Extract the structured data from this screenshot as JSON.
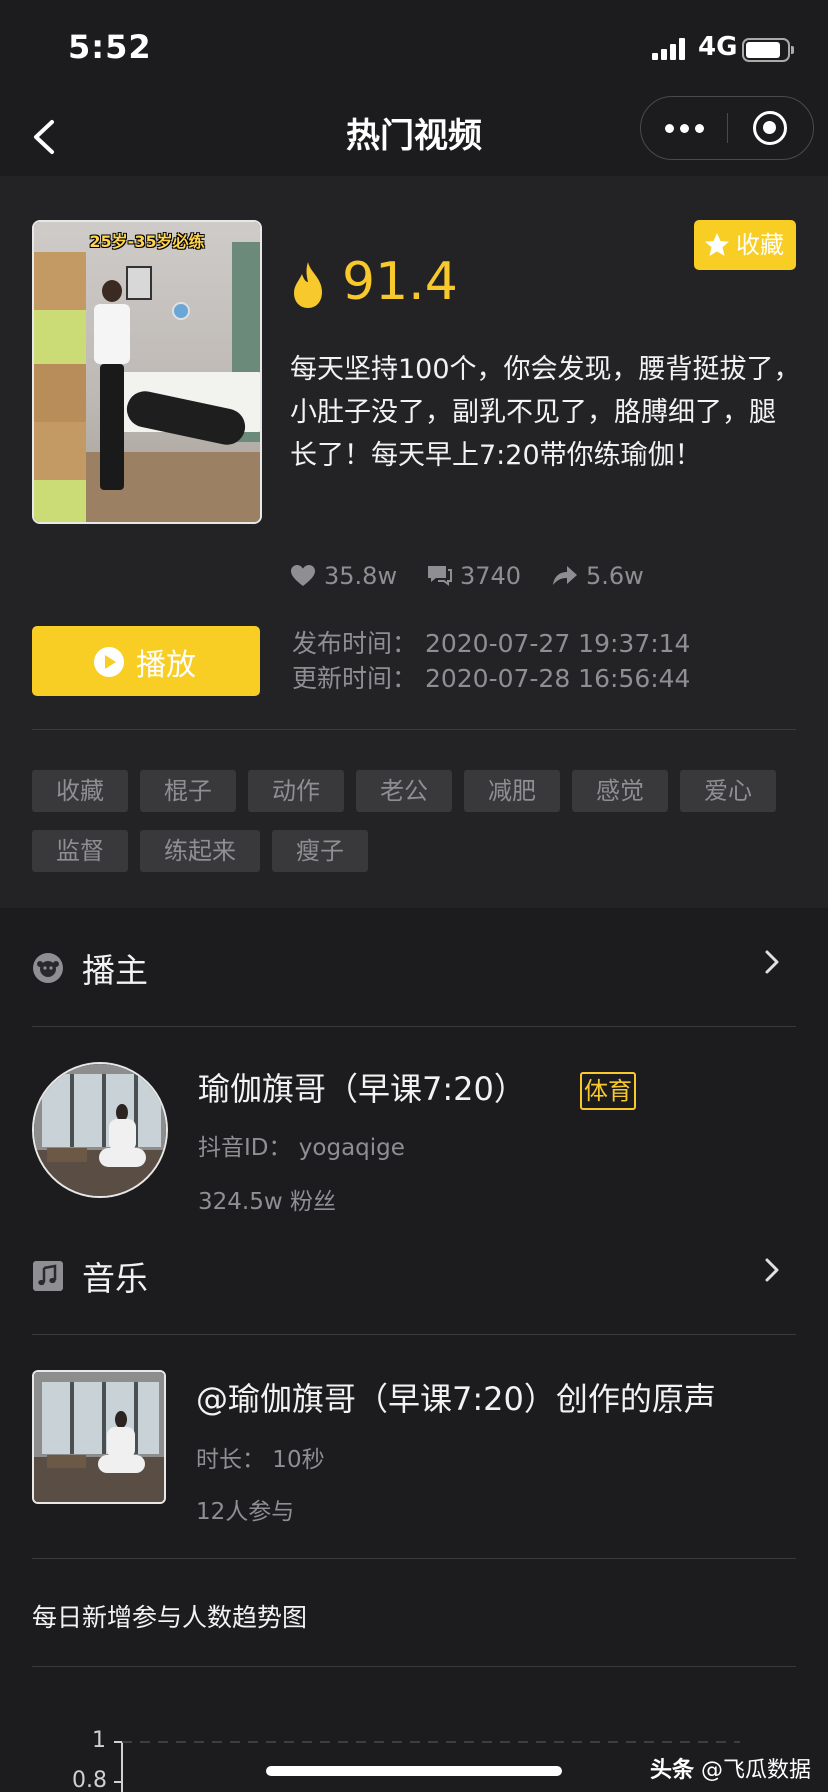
{
  "status_bar": {
    "time": "5:52",
    "network": "4G"
  },
  "nav": {
    "title": "热门视频"
  },
  "video": {
    "thumb_caption": "25岁-35岁必练",
    "favorite_label": "收藏",
    "heat_score": "91.4",
    "description": "每天坚持100个，你会发现，腰背挺拔了，小肚子没了，副乳不见了，胳膊细了，腿长了！每天早上7:20带你练瑜伽！",
    "likes": "35.8w",
    "comments": "3740",
    "shares": "5.6w",
    "play_label": "播放",
    "publish_time": "发布时间：  2020-07-27 19:37:14",
    "update_time": "更新时间：  2020-07-28 16:56:44",
    "tags": [
      "收藏",
      "棍子",
      "动作",
      "老公",
      "减肥",
      "感觉",
      "爱心",
      "监督",
      "练起来",
      "瘦子"
    ]
  },
  "host_section": {
    "title": "播主",
    "name": "瑜伽旗哥（早课7:20）",
    "category": "体育",
    "douyin_id": "抖音ID：  yogaqige",
    "fans": "324.5w 粉丝"
  },
  "music_section": {
    "title": "音乐",
    "name": "@瑜伽旗哥（早课7:20）创作的原声",
    "duration": "时长：  10秒",
    "participants": "12人参与"
  },
  "trend": {
    "title": "每日新增参与人数趋势图",
    "y_ticks": [
      "1",
      "0.8"
    ]
  },
  "watermark": {
    "brand": "头条",
    "handle": "@飞瓜数据"
  },
  "colors": {
    "accent": "#f8cd24",
    "score": "#f8c92c",
    "background": "#1c1c1e",
    "card": "#232326"
  }
}
